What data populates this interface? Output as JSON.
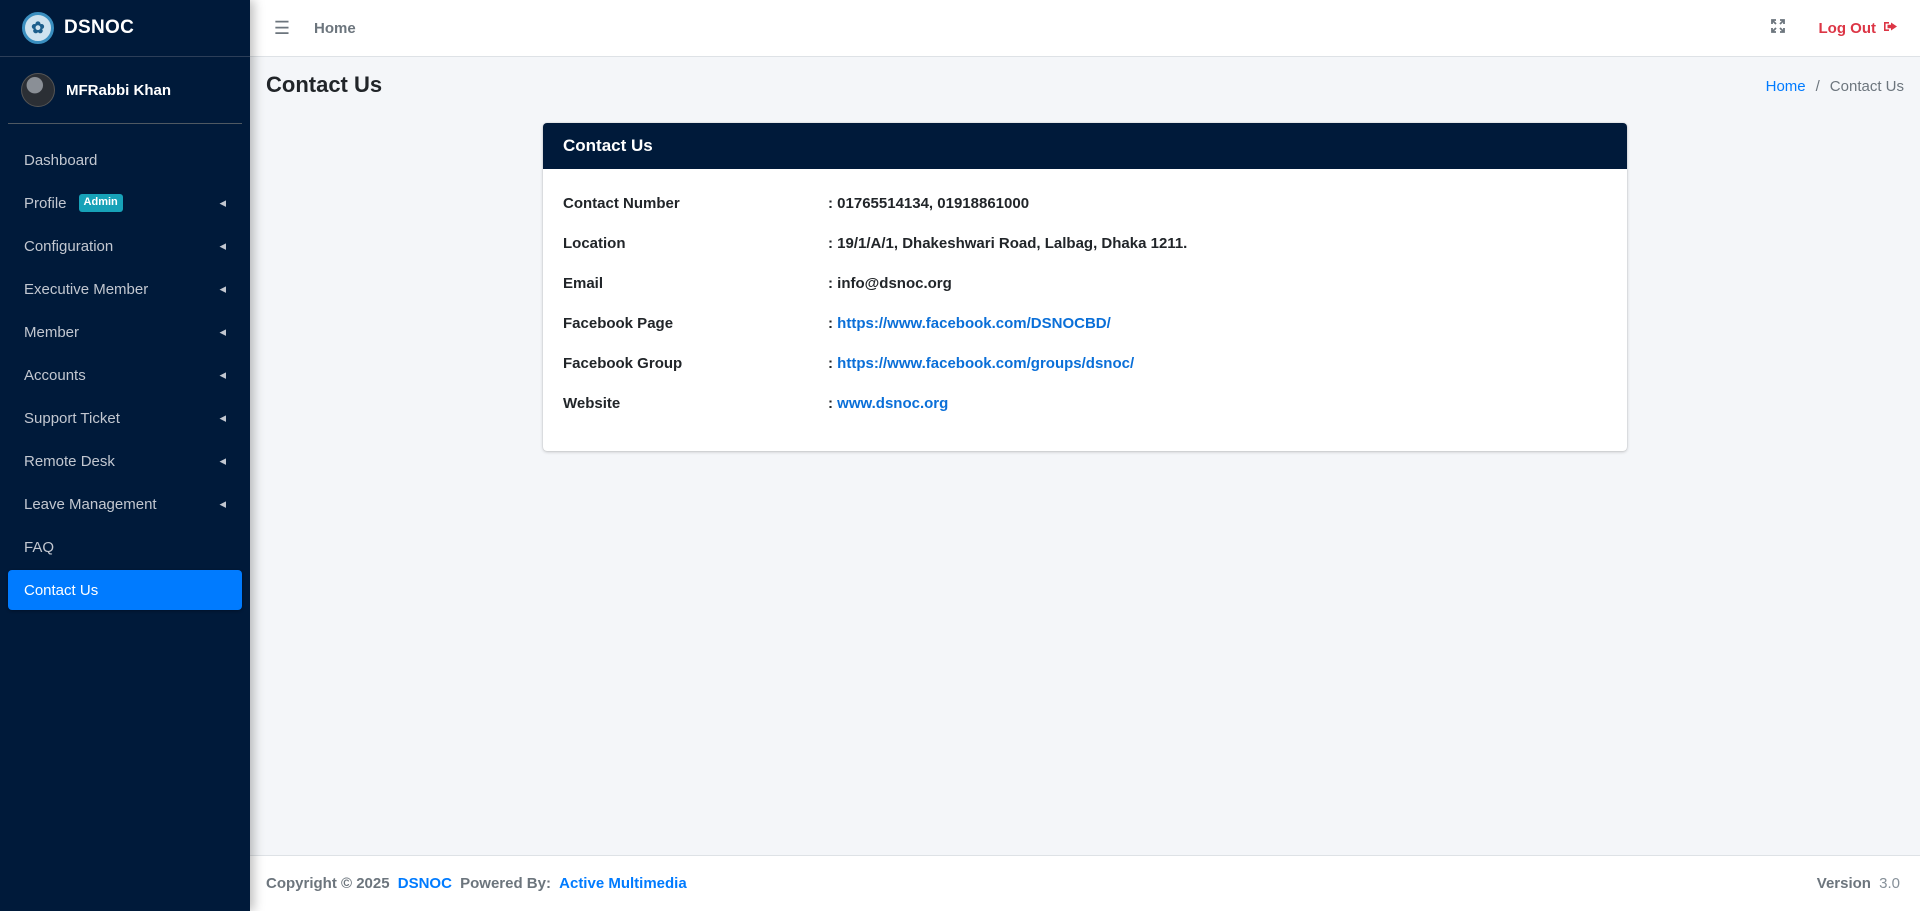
{
  "brand": {
    "name": "DSNOC",
    "logo_icon": "dsnoc-logo"
  },
  "user": {
    "name": "MFRabbi Khan"
  },
  "sidebar": {
    "items": [
      {
        "label": "Dashboard",
        "has_submenu": false
      },
      {
        "label": "Profile",
        "badge": "Admin",
        "has_submenu": true
      },
      {
        "label": "Configuration",
        "has_submenu": true
      },
      {
        "label": "Executive Member",
        "has_submenu": true
      },
      {
        "label": "Member",
        "has_submenu": true
      },
      {
        "label": "Accounts",
        "has_submenu": true
      },
      {
        "label": "Support Ticket",
        "has_submenu": true
      },
      {
        "label": "Remote Desk",
        "has_submenu": true
      },
      {
        "label": "Leave Management",
        "has_submenu": true
      },
      {
        "label": "FAQ",
        "has_submenu": false
      },
      {
        "label": "Contact Us",
        "has_submenu": false,
        "active": true
      }
    ]
  },
  "topbar": {
    "home_label": "Home",
    "logout_label": "Log Out",
    "icons": [
      "menu-icon",
      "fullscreen-icon",
      "logout-icon"
    ]
  },
  "page": {
    "title": "Contact Us",
    "breadcrumb": {
      "home": "Home",
      "separator": "/",
      "current": "Contact Us"
    }
  },
  "card": {
    "title": "Contact Us",
    "rows": [
      {
        "label": "Contact Number",
        "prefix": ": ",
        "value": "01765514134, 01918861000",
        "is_link": false
      },
      {
        "label": "Location",
        "prefix": ": ",
        "value": "19/1/A/1, Dhakeshwari Road, Lalbag, Dhaka 1211.",
        "is_link": false
      },
      {
        "label": "Email",
        "prefix": ": ",
        "value": "info@dsnoc.org",
        "is_link": false
      },
      {
        "label": "Facebook Page",
        "prefix": ": ",
        "value": "https://www.facebook.com/DSNOCBD/",
        "is_link": true
      },
      {
        "label": "Facebook Group",
        "prefix": ": ",
        "value": "https://www.facebook.com/groups/dsnoc/",
        "is_link": true
      },
      {
        "label": "Website",
        "prefix": ": ",
        "value": "www.dsnoc.org",
        "is_link": true
      }
    ]
  },
  "footer": {
    "copyright_prefix": "Copyright © 2025",
    "brand_link": "DSNOC",
    "powered_by": "Powered By:",
    "company_link": "Active Multimedia",
    "version_label": "Version",
    "version_value": "3.0"
  },
  "colors": {
    "sidebar_bg": "#001a3a",
    "active_item": "#007bff",
    "link": "#0a6fd8",
    "logout": "#dc3545",
    "badge": "#17a2b8"
  }
}
